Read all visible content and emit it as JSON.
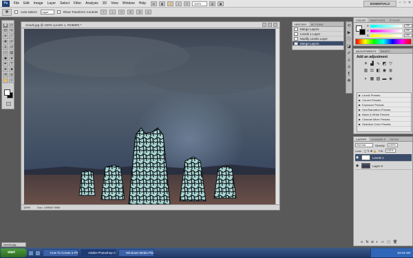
{
  "menubar": {
    "logo": "Ps",
    "items": [
      "File",
      "Edit",
      "Image",
      "Layer",
      "Select",
      "Filter",
      "Analysis",
      "3D",
      "View",
      "Window",
      "Help"
    ],
    "zoom": "100%",
    "workspace": "ESSENTIALS"
  },
  "options": {
    "auto_select_label": "Auto-Select:",
    "auto_select_value": "Layer",
    "transform_label": "Show Transform Controls"
  },
  "document": {
    "title": "clouds.jpg @ 100% (Levels 1, RGB/8#) *",
    "zoom": "100%",
    "doc_info": "Doc: 4.59M/7.98M"
  },
  "history": {
    "tabs": [
      "HISTORY",
      "ACTIONS"
    ],
    "items": [
      "Merge Layers",
      "Levels 1 Layer",
      "Modify Levels Layer",
      "Merge Layers"
    ]
  },
  "color_panel": {
    "tabs": [
      "COLOR",
      "SWATCHES",
      "STYLES"
    ],
    "r_label": "R",
    "g_label": "G",
    "b_label": "B",
    "r": "255",
    "g": "255",
    "b": "255"
  },
  "adjustments": {
    "tabs": [
      "ADJUSTMENTS",
      "MASKS"
    ],
    "title": "Add an adjustment",
    "presets": [
      "Levels Presets",
      "Curves Presets",
      "Exposure Presets",
      "Hue/Saturation Presets",
      "Black & White Presets",
      "Channel Mixer Presets",
      "Selective Color Presets"
    ]
  },
  "layers": {
    "tabs": [
      "LAYERS",
      "CHANNELS",
      "PATHS"
    ],
    "blend_mode": "Normal",
    "opacity_label": "Opacity:",
    "opacity": "100%",
    "lock_label": "Lock:",
    "fill_label": "Fill:",
    "fill": "100%",
    "items": [
      "Levels 1",
      "Layer 0"
    ]
  },
  "taskbar": {
    "start": "start",
    "tasks": [
      "How To Create a Phot...",
      "Adobe Photoshop CS4 ...",
      "Windows Media Player"
    ],
    "time": "10:43 AM",
    "minimized": "clouds.jpg..."
  }
}
